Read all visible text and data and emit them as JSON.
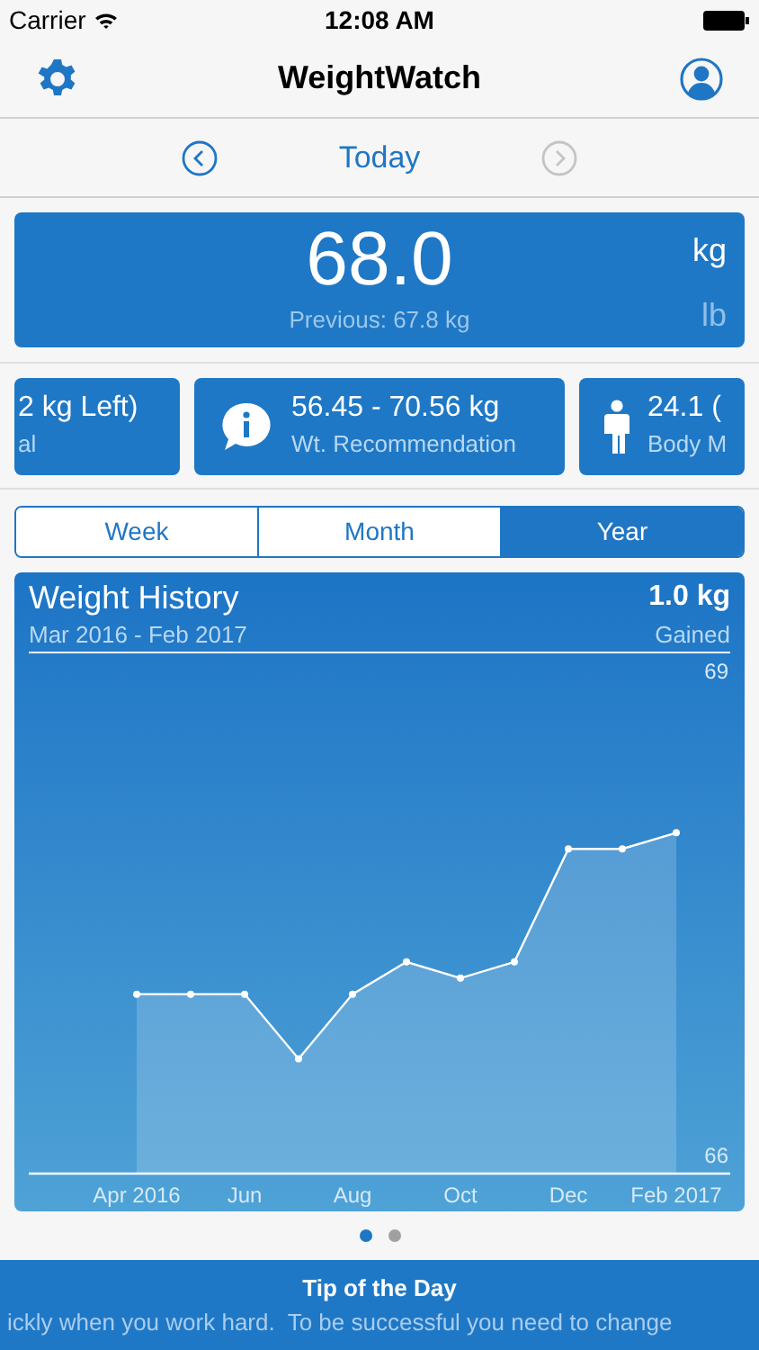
{
  "status_bar": {
    "carrier": "Carrier",
    "time": "12:08 AM"
  },
  "nav": {
    "title": "WeightWatch"
  },
  "date_nav": {
    "label": "Today",
    "prev_disabled": false,
    "next_disabled": true
  },
  "weight": {
    "value": "68.0",
    "previous": "Previous: 67.8 kg",
    "units": [
      {
        "label": "kg",
        "selected": true
      },
      {
        "label": "lb",
        "selected": false
      }
    ]
  },
  "info_cards": [
    {
      "kind": "plain",
      "value": "2 kg Left)",
      "caption": "al"
    },
    {
      "kind": "info",
      "value": "56.45 - 70.56 kg",
      "caption": "Wt. Recommendation"
    },
    {
      "kind": "person",
      "value": "24.1 (",
      "caption": "Body M"
    }
  ],
  "range_tabs": [
    {
      "label": "Week",
      "selected": false
    },
    {
      "label": "Month",
      "selected": false
    },
    {
      "label": "Year",
      "selected": true
    }
  ],
  "history": {
    "title": "Weight History",
    "range": "Mar 2016 - Feb 2017",
    "change": "1.0 kg",
    "change_label": "Gained",
    "chart_data": {
      "type": "area",
      "categories": [
        "Apr 2016",
        null,
        "Jun",
        null,
        "Aug",
        null,
        "Oct",
        null,
        "Dec",
        null,
        "Feb 2017"
      ],
      "series": [
        {
          "color": "#ffffff",
          "values": [
            67.0,
            67.0,
            67.0,
            66.6,
            67.0,
            67.2,
            67.1,
            67.2,
            67.9,
            67.9,
            68.0
          ]
        }
      ],
      "ylim": [
        66,
        69
      ],
      "yticks": [
        66,
        69
      ]
    }
  },
  "page_dots": [
    {
      "selected": true
    },
    {
      "selected": false
    }
  ],
  "tip": {
    "title": "Tip of the Day",
    "text": "ickly when you work hard.  To be successful you need to change"
  }
}
